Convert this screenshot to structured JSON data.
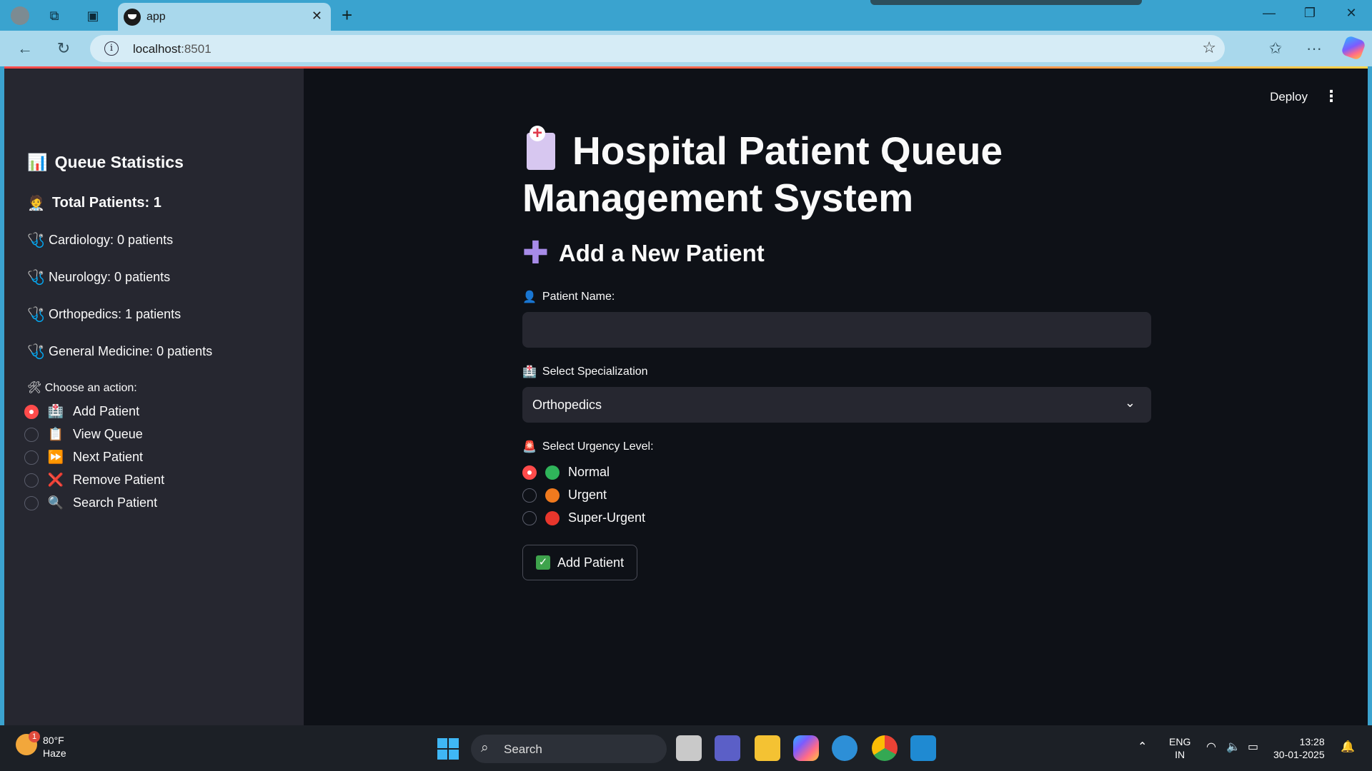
{
  "browser": {
    "tab_title": "app",
    "url_host": "localhost",
    "url_port": ":8501"
  },
  "sidebar": {
    "title": "Queue Statistics",
    "total": "Total Patients: 1",
    "specs": [
      "Cardiology: 0 patients",
      "Neurology: 0 patients",
      "Orthopedics: 1 patients",
      "General Medicine: 0 patients"
    ],
    "choose_label": "🛠 Choose an action:",
    "actions": [
      {
        "emoji": "🏥",
        "label": "Add Patient",
        "selected": true
      },
      {
        "emoji": "📋",
        "label": "View Queue",
        "selected": false
      },
      {
        "emoji": "⏩",
        "label": "Next Patient",
        "selected": false
      },
      {
        "emoji": "❌",
        "label": "Remove Patient",
        "selected": false
      },
      {
        "emoji": "🔍",
        "label": "Search Patient",
        "selected": false
      }
    ]
  },
  "header": {
    "deploy": "Deploy",
    "menu": "⋮"
  },
  "main": {
    "title": "Hospital Patient Queue Management System",
    "subtitle": "Add a New Patient",
    "name_label": "Patient Name:",
    "name_value": "",
    "spec_label": "Select Specialization",
    "spec_value": "Orthopedics",
    "urgency_label": "Select Urgency Level:",
    "urgency": [
      {
        "label": "Normal",
        "color": "#2fb45a",
        "selected": true
      },
      {
        "label": "Urgent",
        "color": "#f07a1e",
        "selected": false
      },
      {
        "label": "Super-Urgent",
        "color": "#e8362c",
        "selected": false
      }
    ],
    "add_button": "Add Patient"
  },
  "taskbar": {
    "temp": "80°F",
    "condition": "Haze",
    "weather_badge": "1",
    "search": "Search",
    "lang1": "ENG",
    "lang2": "IN",
    "time": "13:28",
    "date": "30-01-2025"
  }
}
